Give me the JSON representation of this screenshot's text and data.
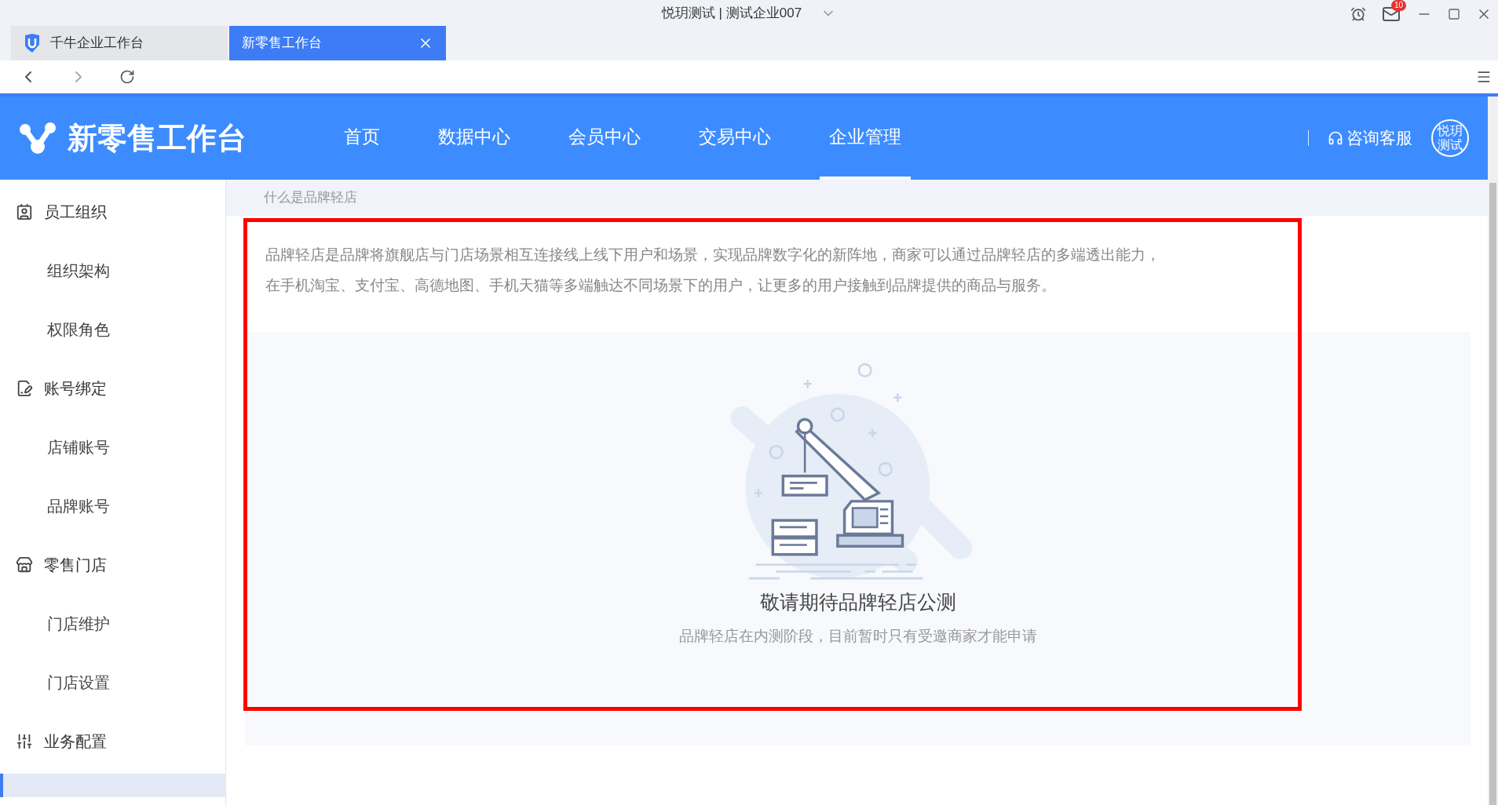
{
  "window": {
    "title": "悦玥测试 | 测试企业007",
    "mail_badge": "10"
  },
  "tabs": [
    {
      "label": "千牛企业工作台",
      "selected": false
    },
    {
      "label": "新零售工作台",
      "selected": true
    }
  ],
  "header": {
    "logo": "新零售工作台",
    "nav": [
      {
        "label": "首页",
        "selected": false
      },
      {
        "label": "数据中心",
        "selected": false
      },
      {
        "label": "会员中心",
        "selected": false
      },
      {
        "label": "交易中心",
        "selected": false
      },
      {
        "label": "企业管理",
        "selected": true
      }
    ],
    "service": "咨询客服",
    "avatar": "悦玥测试"
  },
  "sidebar": {
    "groups": [
      {
        "label": "员工组织",
        "children": [
          {
            "label": "组织架构",
            "selected": false
          },
          {
            "label": "权限角色",
            "selected": false
          }
        ]
      },
      {
        "label": "账号绑定",
        "children": [
          {
            "label": "店铺账号",
            "selected": false
          },
          {
            "label": "品牌账号",
            "selected": false
          }
        ]
      },
      {
        "label": "零售门店",
        "children": [
          {
            "label": "门店维护",
            "selected": false
          },
          {
            "label": "门店设置",
            "selected": false
          }
        ]
      },
      {
        "label": "业务配置"
      }
    ]
  },
  "content": {
    "breadcrumb": "什么是品牌轻店",
    "description": "品牌轻店是品牌将旗舰店与门店场景相互连接线上线下用户和场景，实现品牌数字化的新阵地，商家可以通过品牌轻店的多端透出能力，在手机淘宝、支付宝、高德地图、手机天猫等多端触达不同场景下的用户，让更多的用户接触到品牌提供的商品与服务。",
    "empty_state": {
      "title": "敬请期待品牌轻店公测",
      "subtitle": "品牌轻店在内测阶段，目前暂时只有受邀商家才能申请"
    }
  }
}
